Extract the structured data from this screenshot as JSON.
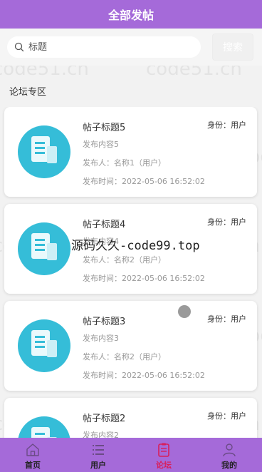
{
  "header": {
    "title": "全部发帖"
  },
  "search": {
    "placeholder": "标题",
    "button_label": "搜索"
  },
  "section": {
    "title": "论坛专区"
  },
  "posts": [
    {
      "title": "帖子标题5",
      "identity": "身份：用户",
      "content": "发布内容5",
      "author": "发布人：名称1（用户）",
      "time": "发布时间：2022-05-06 16:52:02"
    },
    {
      "title": "帖子标题4",
      "identity": "身份：用户",
      "content": "发布内容4",
      "author": "发布人：名称2（用户）",
      "time": "发布时间：2022-05-06 16:52:02"
    },
    {
      "title": "帖子标题3",
      "identity": "身份：用户",
      "content": "发布内容3",
      "author": "发布人：名称2（用户）",
      "time": "发布时间：2022-05-06 16:52:02"
    },
    {
      "title": "帖子标题2",
      "identity": "身份：用户",
      "content": "发布内容2",
      "author": "",
      "time": ""
    }
  ],
  "overlay": {
    "text": "源码久久-code99.top"
  },
  "watermark": {
    "text": "code51.cn"
  },
  "tabs": [
    {
      "label": "首页",
      "icon": "home-icon"
    },
    {
      "label": "用户",
      "icon": "list-icon"
    },
    {
      "label": "论坛",
      "icon": "clipboard-icon",
      "active": true
    },
    {
      "label": "我的",
      "icon": "person-icon"
    }
  ],
  "colors": {
    "primary": "#a56ad9",
    "post_icon": "#35bdd8",
    "active_tab": "#d81e5b"
  }
}
